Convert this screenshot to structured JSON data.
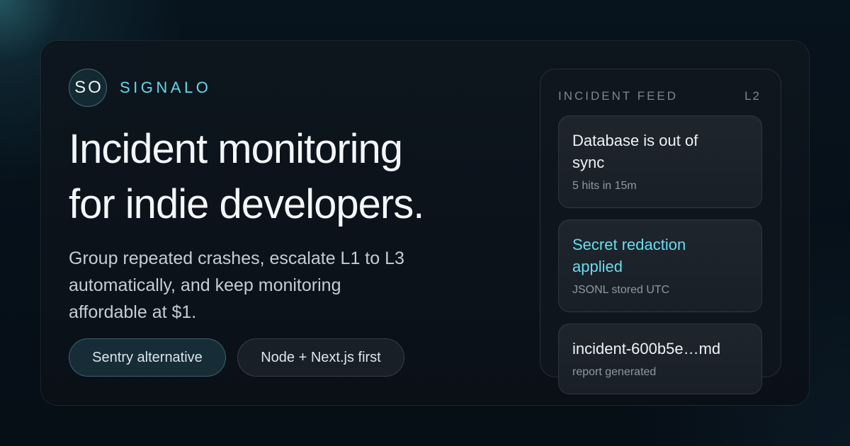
{
  "brand": {
    "logo_initials": "SO",
    "name": "SIGNALO"
  },
  "hero": {
    "headline_line1": "Incident monitoring",
    "headline_line2": "for indie developers.",
    "subtitle_line1": "Group repeated crashes, escalate L1 to L3",
    "subtitle_line2": "automatically, and keep monitoring",
    "subtitle_line3": "affordable at $1."
  },
  "tags": [
    {
      "label": "Sentry alternative"
    },
    {
      "label": "Node + Next.js first"
    }
  ],
  "feed": {
    "title": "INCIDENT FEED",
    "level": "L2",
    "items": [
      {
        "title_line1": "Database is out of",
        "title_line2": "sync",
        "detail": "5 hits in 15m"
      },
      {
        "title_line1": "Secret redaction",
        "title_line2": "applied",
        "detail": "JSONL stored UTC"
      },
      {
        "title_line1": "incident-600b5e…md",
        "detail": "report generated"
      }
    ]
  },
  "colors": {
    "accent": "#62d9ec",
    "background": "#06101a",
    "card": "#0e161e",
    "text_primary": "#f4f7fa",
    "text_muted": "#8d98a4"
  }
}
